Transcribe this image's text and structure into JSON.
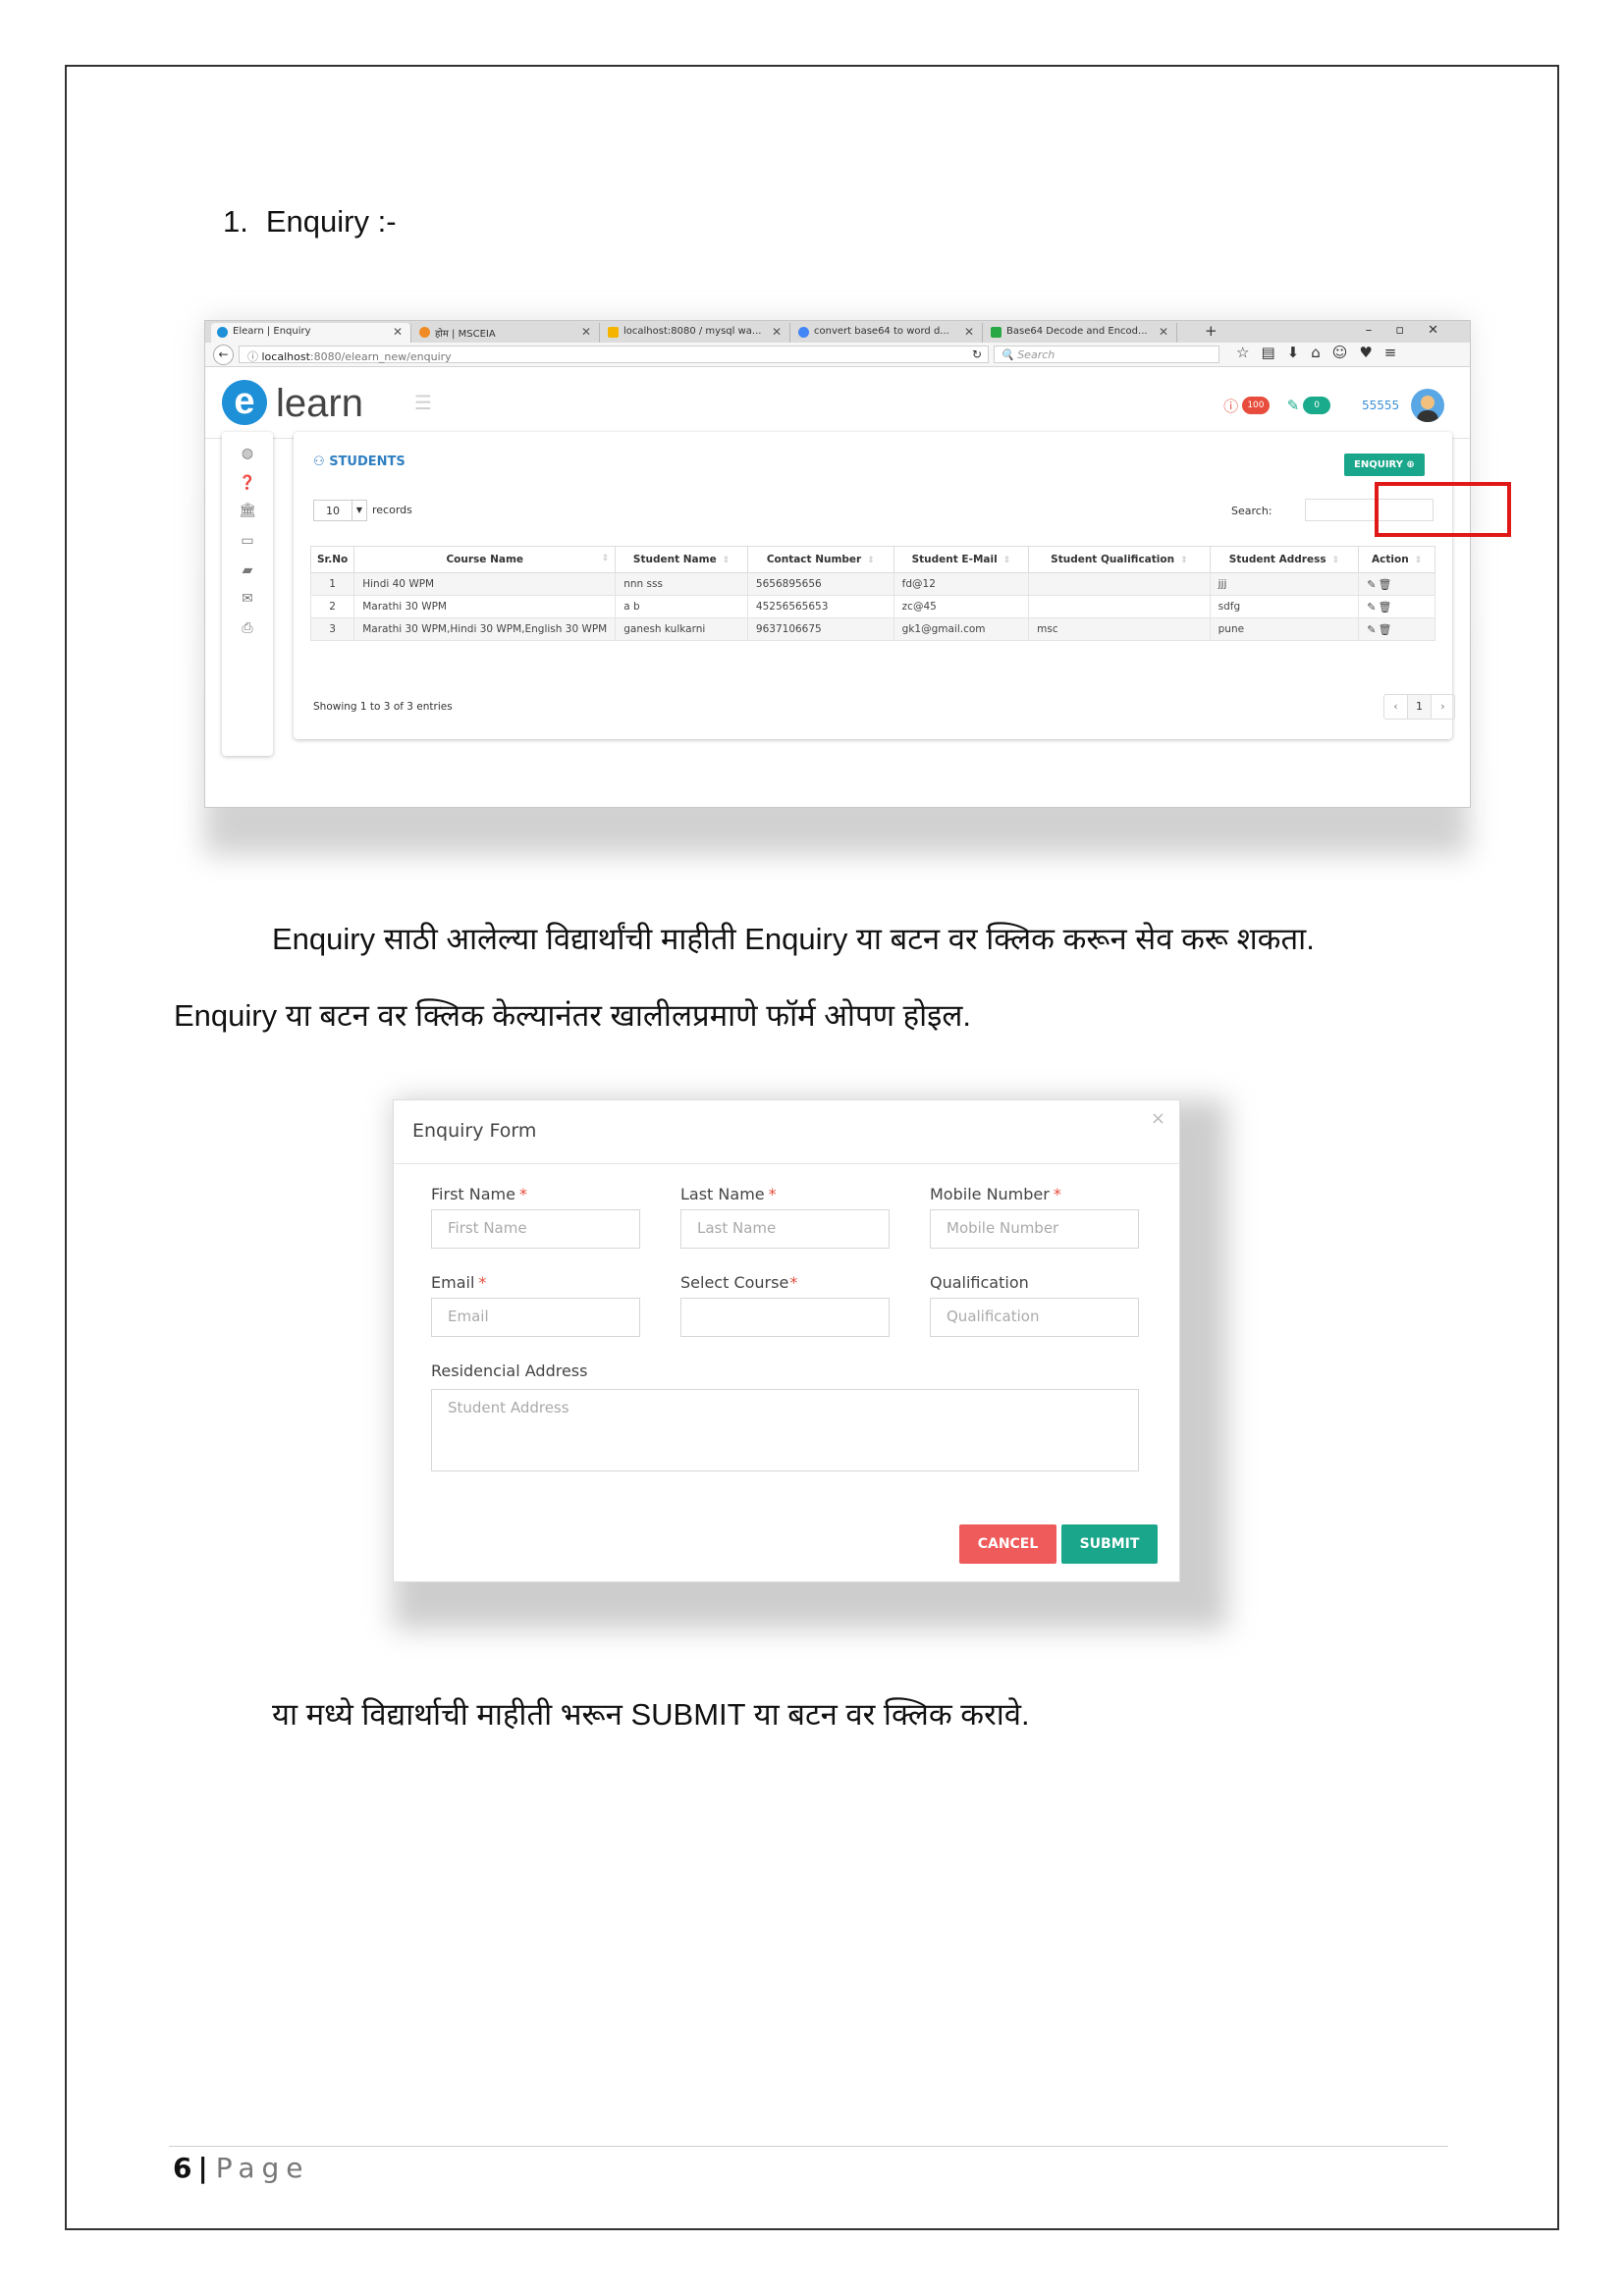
{
  "heading": {
    "number": "1.",
    "text": "Enquiry :-"
  },
  "browser": {
    "tabs": [
      {
        "label": "Elearn | Enquiry",
        "color": "#1e90d8"
      },
      {
        "label": "होम | MSCEIA",
        "color": "#f08a24"
      },
      {
        "label": "localhost:8080 / mysql wa...",
        "color": "#f4b400"
      },
      {
        "label": "convert base64 to word d...",
        "color": "#4285f4"
      },
      {
        "label": "Base64 Decode and Encod...",
        "color": "#27a844"
      }
    ],
    "url_host": "localhost",
    "url_path": ":8080/elearn_new/enquiry",
    "search_placeholder": "Search"
  },
  "app": {
    "logo_letter": "e",
    "logo_text": "learn",
    "notification_count": "100",
    "task_count": "0",
    "user_id": "55555"
  },
  "students": {
    "title": "STUDENTS",
    "enquiry_button": "ENQUIRY",
    "page_length": "10",
    "records_label": "records",
    "search_label": "Search:",
    "columns": [
      "Sr.No",
      "Course Name",
      "Student Name",
      "Contact Number",
      "Student E-Mail",
      "Student Qualification",
      "Student Address",
      "Action"
    ],
    "rows": [
      [
        "1",
        "Hindi 40 WPM",
        "nnn sss",
        "5656895656",
        "fd@12",
        "",
        "jjj"
      ],
      [
        "2",
        "Marathi 30 WPM",
        "a b",
        "45256565653",
        "zc@45",
        "",
        "sdfg"
      ],
      [
        "3",
        "Marathi 30 WPM,Hindi 30 WPM,English 30 WPM",
        "ganesh kulkarni",
        "9637106675",
        "gk1@gmail.com",
        "msc",
        "pune"
      ]
    ],
    "info": "Showing 1 to 3 of 3 entries",
    "pager": {
      "prev": "‹",
      "current": "1",
      "next": "›"
    }
  },
  "paragraphs": {
    "p1": "Enquiry साठी आलेल्या विद्यार्थांची माहीती Enquiry या बटन वर क्लिक करून सेव करू शकता.",
    "p2": "Enquiry या बटन वर क्लिक केल्यानंतर खालीलप्रमाणे फॉर्म ओपण होइल.",
    "p3": "या मध्ये विद्यार्थाची माहीती भरून SUBMIT या बटन वर क्लिक करावे."
  },
  "form": {
    "title": "Enquiry Form",
    "close": "×",
    "first_name_label": "First Name",
    "first_name_placeholder": "First Name",
    "last_name_label": "Last Name",
    "last_name_placeholder": "Last Name",
    "mobile_label": "Mobile Number",
    "mobile_placeholder": "Mobile Number",
    "email_label": "Email",
    "email_placeholder": "Email",
    "course_label": "Select Course",
    "qualification_label": "Qualification",
    "qualification_placeholder": "Qualification",
    "address_label": "Residencial Address",
    "address_placeholder": "Student Address",
    "required_mark": "*",
    "cancel_label": "CANCEL",
    "submit_label": "SUBMIT"
  },
  "footer": {
    "page_number": "6",
    "separator": "|",
    "page_word": "Page"
  },
  "colors": {
    "accent": "#1aa68a",
    "danger": "#ef5a5a",
    "highlight": "#e01818",
    "brand_blue": "#1e90d8"
  }
}
